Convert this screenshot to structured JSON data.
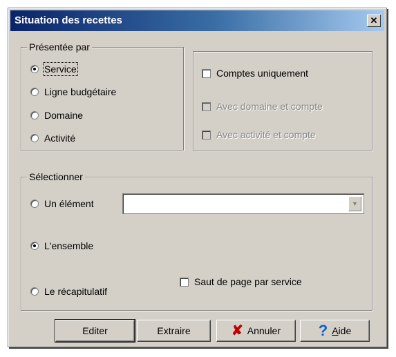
{
  "window": {
    "title": "Situation des recettes"
  },
  "presentee": {
    "legend": "Présentée par",
    "options": [
      {
        "label": "Service",
        "checked": true
      },
      {
        "label": "Ligne budgétaire",
        "checked": false
      },
      {
        "label": "Domaine",
        "checked": false
      },
      {
        "label": "Activité",
        "checked": false
      }
    ]
  },
  "checks": [
    {
      "label": "Comptes uniquement",
      "checked": false,
      "enabled": true
    },
    {
      "label": "Avec domaine et compte",
      "checked": false,
      "enabled": false
    },
    {
      "label": "Avec activité et compte",
      "checked": false,
      "enabled": false
    }
  ],
  "selectionner": {
    "legend": "Sélectionner",
    "un_element": {
      "label": "Un élément",
      "checked": false
    },
    "combo_value": "",
    "ensemble": {
      "label": "L'ensemble",
      "checked": true
    },
    "recap": {
      "label": "Le récapitulatif",
      "checked": false
    },
    "saut_page": {
      "label": "Saut de page par service",
      "checked": false
    }
  },
  "buttons": {
    "editer": "Editer",
    "extraire": "Extraire",
    "annuler": "Annuler",
    "aide_accel": "A",
    "aide_rest": "ide"
  }
}
